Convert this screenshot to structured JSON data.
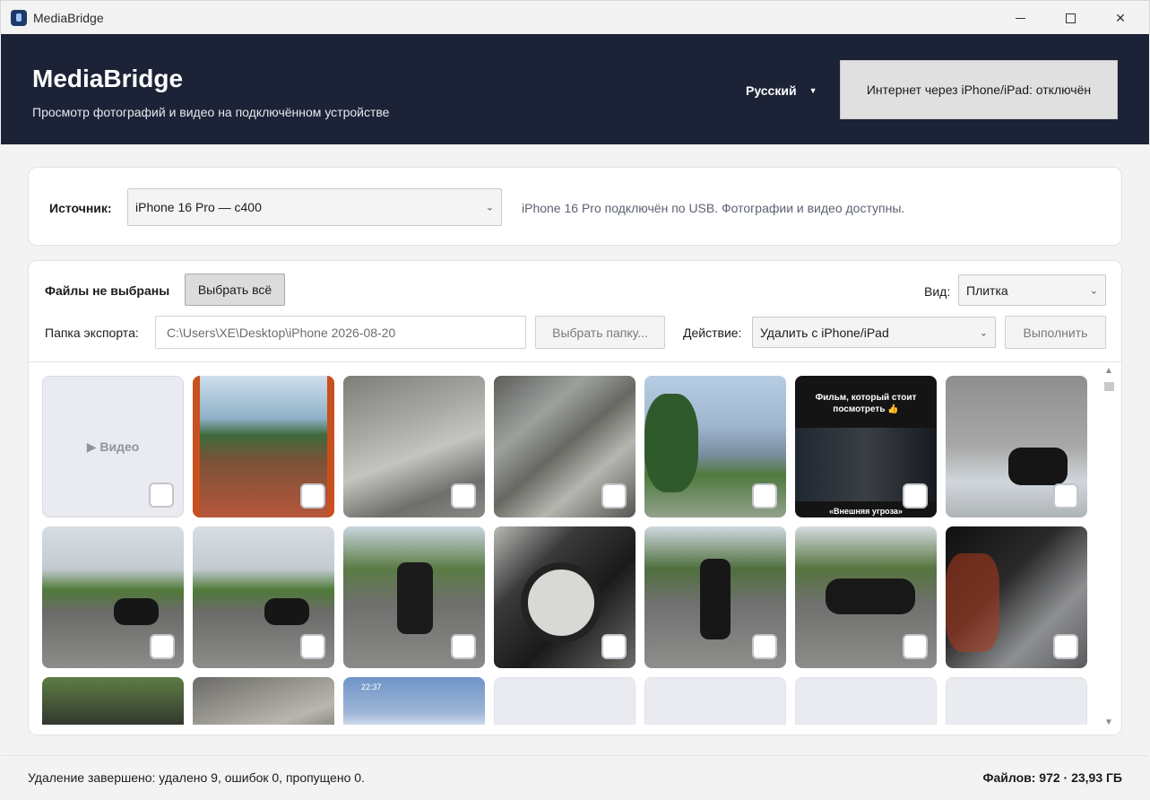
{
  "window": {
    "title": "MediaBridge"
  },
  "header": {
    "title": "MediaBridge",
    "subtitle": "Просмотр фотографий и видео на подключённом устройстве",
    "language": "Русский",
    "internet_button": "Интернет через iPhone/iPad: отключён"
  },
  "source": {
    "label": "Источник:",
    "selected": "iPhone 16 Pro — c400",
    "status": "iPhone 16 Pro подключён по USB. Фотографии и видео доступны."
  },
  "toolbar": {
    "selection_label": "Файлы не выбраны",
    "select_all": "Выбрать всё",
    "view_label": "Вид:",
    "view_selected": "Плитка",
    "export_label": "Папка экспорта:",
    "export_path": "C:\\Users\\XE\\Desktop\\iPhone 2026-08-20",
    "choose_folder": "Выбрать папку...",
    "action_label": "Действие:",
    "action_selected": "Удалить с iPhone/iPad",
    "execute": "Выполнить"
  },
  "grid": {
    "video_label": "▶ Видео",
    "film_title": "Фильм, который стоит посмотреть 👍",
    "film_subtitle": "«Внешняя угроза»",
    "phone_time": "22:37"
  },
  "status": {
    "message": "Удаление завершено: удалено 9, ошибок 0, пропущено 0.",
    "files": "Файлов: 972 · 23,93 ГБ"
  },
  "icons": [
    "app-icon",
    "minimize-icon",
    "maximize-icon",
    "close-icon",
    "chevron-down-icon",
    "scroll-up-icon",
    "scroll-down-icon"
  ],
  "colors": {
    "header_bg": "#1c2336",
    "accent_button": "#e0e0e0"
  }
}
